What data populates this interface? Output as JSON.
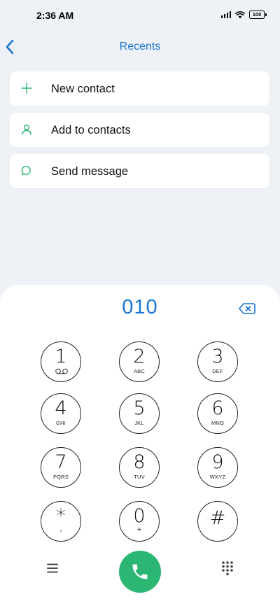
{
  "status_bar": {
    "time": "2:36 AM",
    "battery": "100"
  },
  "header": {
    "title": "Recents",
    "back_icon": "chevron-left-icon"
  },
  "actions": [
    {
      "label": "New contact",
      "icon": "plus-icon"
    },
    {
      "label": "Add to contacts",
      "icon": "person-icon"
    },
    {
      "label": "Send message",
      "icon": "message-bubble-icon"
    }
  ],
  "dialer": {
    "number": "010",
    "keys": [
      {
        "digit": "1",
        "letters": ""
      },
      {
        "digit": "2",
        "letters": "ABC"
      },
      {
        "digit": "3",
        "letters": "DEF"
      },
      {
        "digit": "4",
        "letters": "GHI"
      },
      {
        "digit": "5",
        "letters": "JKL"
      },
      {
        "digit": "6",
        "letters": "MNO"
      },
      {
        "digit": "7",
        "letters": "PQRS"
      },
      {
        "digit": "8",
        "letters": "TUV"
      },
      {
        "digit": "9",
        "letters": "WXYZ"
      },
      {
        "digit": "*",
        "letters": ","
      },
      {
        "digit": "0",
        "letters": "+"
      },
      {
        "digit": "#",
        "letters": ""
      }
    ]
  },
  "colors": {
    "accent": "#1976d2",
    "action_icon": "#2bb673",
    "call_button": "#2bb673",
    "background": "#eef1f5"
  }
}
